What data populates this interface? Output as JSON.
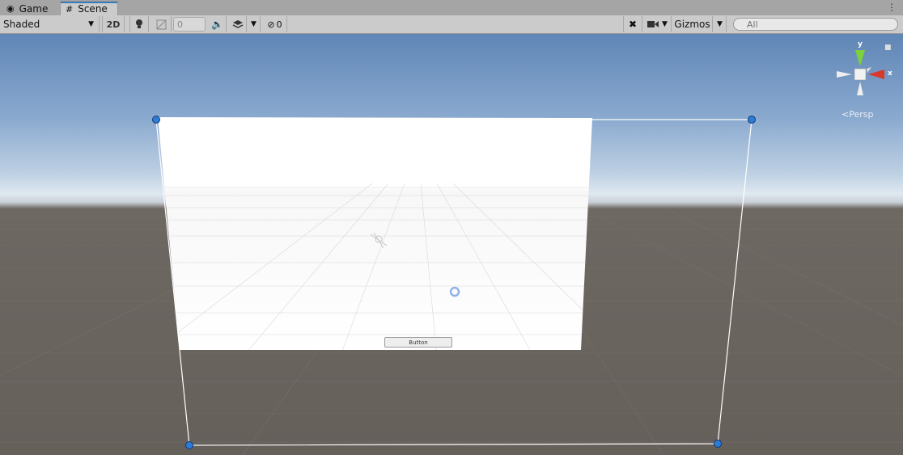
{
  "tabs": [
    {
      "label": "Game",
      "icon": "gamepad-icon"
    },
    {
      "label": "Scene",
      "icon": "hash-icon",
      "active": true
    }
  ],
  "toolbar": {
    "shading_mode": "Shaded",
    "two_d_label": "2D",
    "fx_value": "0",
    "hidden_count": "0",
    "gizmos_label": "Gizmos",
    "search_placeholder": "All"
  },
  "viewport": {
    "ui_button_label": "Button",
    "projection_label": "Persp",
    "gizmo_y_label": "y",
    "gizmo_x_label": "x"
  },
  "colors": {
    "selection_handle": "#2e7bd6",
    "gizmo_y": "#7fd13b",
    "gizmo_x": "#d8392b",
    "sky_top": "#5f86b6",
    "ground": "#66605b"
  }
}
